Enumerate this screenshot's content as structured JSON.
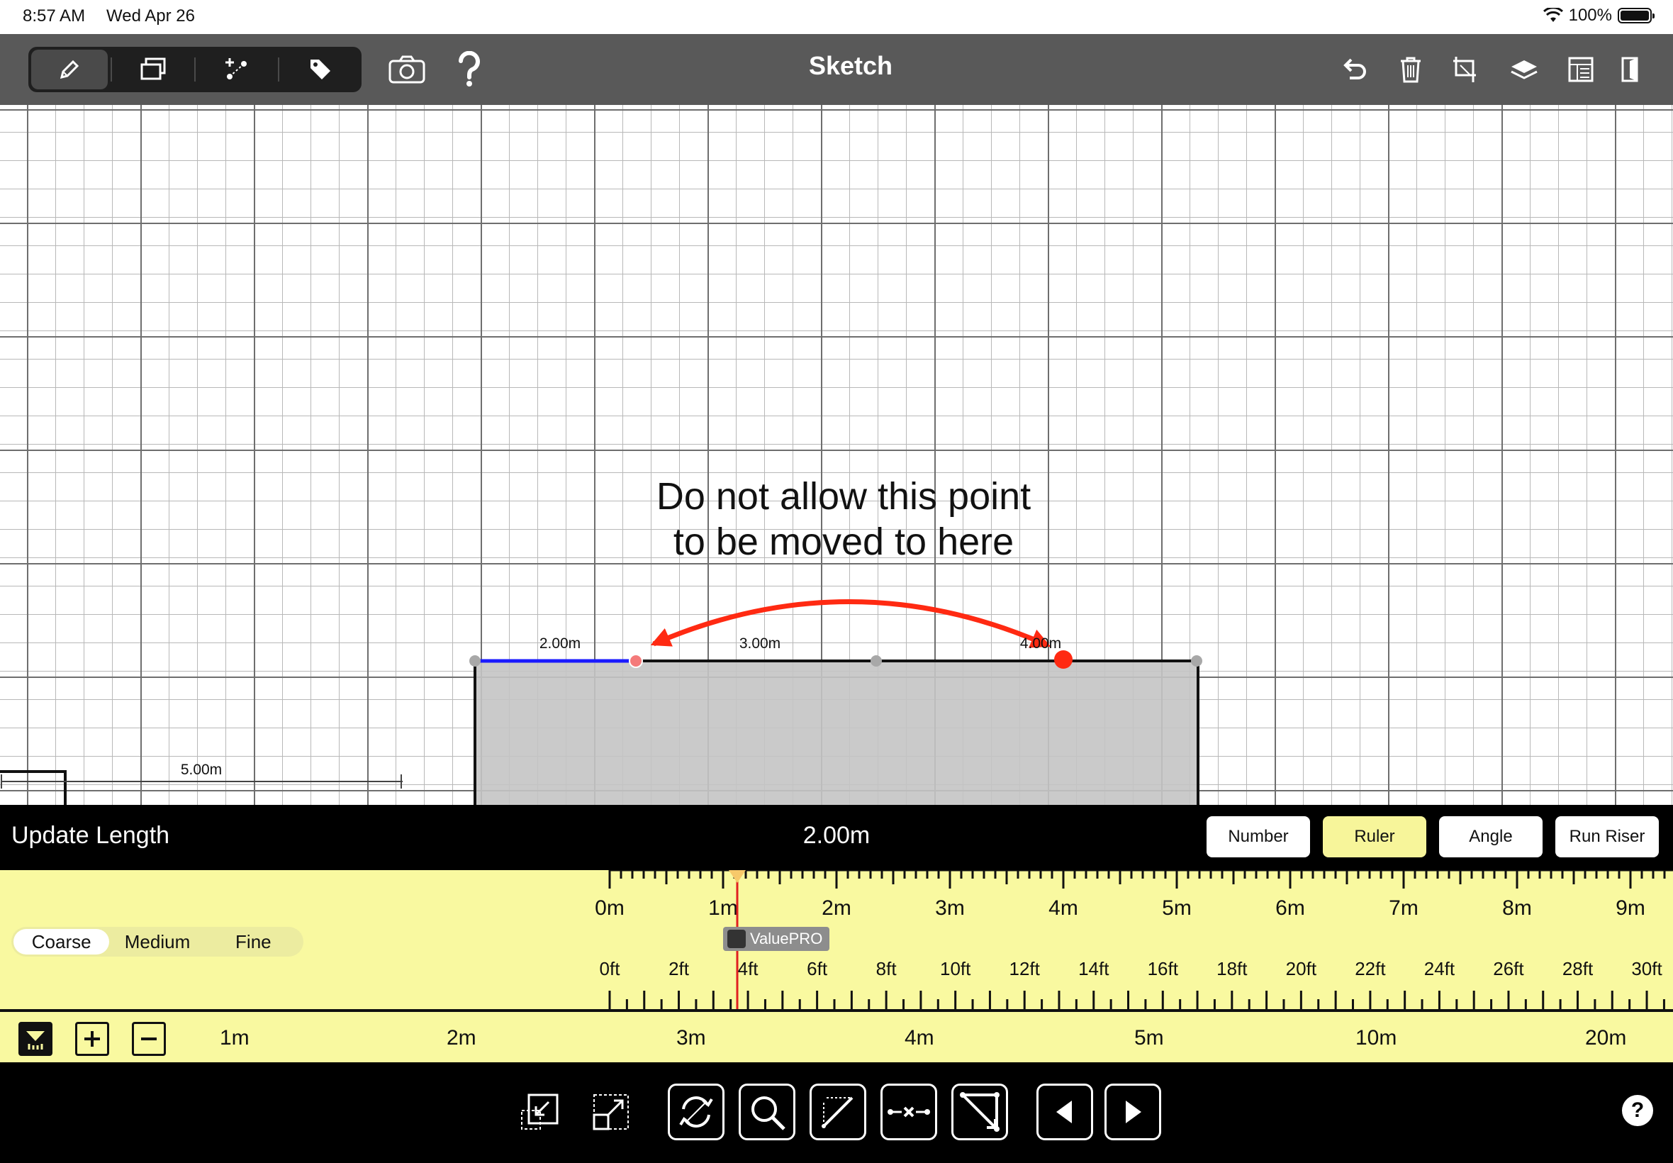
{
  "status_bar": {
    "time": "8:57 AM",
    "date": "Wed Apr 26",
    "battery": "100%",
    "wifi_icon": "wifi-icon"
  },
  "toolbar": {
    "title": "Sketch",
    "segments": [
      "pencil-icon",
      "layers-copy-icon",
      "add-point-icon",
      "tag-icon"
    ],
    "active_segment": "pencil-icon",
    "left_icons": [
      "camera-icon",
      "question-icon"
    ],
    "right_icons": [
      "undo-icon",
      "trash-icon",
      "transform-icon",
      "layers-icon",
      "list-icon",
      "exit-icon"
    ]
  },
  "canvas": {
    "annotation_line1": "Do not allow this point",
    "annotation_line2": "to be moved to here",
    "dimension_labels": {
      "seg1": "2.00m",
      "seg2": "3.00m",
      "seg3": "4.00m",
      "side": "5.00m"
    },
    "colors": {
      "highlight": "#1a1aff",
      "arrow": "#ff2a12",
      "fill": "#c4c4c4",
      "point": "#a8a8a8"
    }
  },
  "update_panel": {
    "label": "Update Length",
    "value": "2.00m",
    "modes": [
      "Number",
      "Ruler",
      "Angle",
      "Run Riser"
    ],
    "active_mode": "Ruler",
    "precision": [
      "Coarse",
      "Medium",
      "Fine"
    ],
    "active_precision": "Coarse",
    "metric_ticks": [
      "0m",
      "1m",
      "2m",
      "3m",
      "4m",
      "5m",
      "6m",
      "7m",
      "8m",
      "9m"
    ],
    "imperial_ticks": [
      "0ft",
      "2ft",
      "4ft",
      "6ft",
      "8ft",
      "10ft",
      "12ft",
      "14ft",
      "16ft",
      "18ft",
      "20ft",
      "22ft",
      "24ft",
      "26ft",
      "28ft",
      "30ft"
    ],
    "logo_text": "ValuePRO"
  },
  "scale_bar": {
    "labels": [
      "1m",
      "2m",
      "3m",
      "4m",
      "5m",
      "10m",
      "20m"
    ],
    "selected_scale": "1m"
  },
  "bottom_bar": {
    "buttons": [
      "shrink-icon",
      "expand-icon",
      "rotate-icon",
      "zoom-icon",
      "draw-line-icon",
      "split-segment-icon",
      "diagonal-icon",
      "previous-icon",
      "next-icon"
    ],
    "help": "?"
  }
}
